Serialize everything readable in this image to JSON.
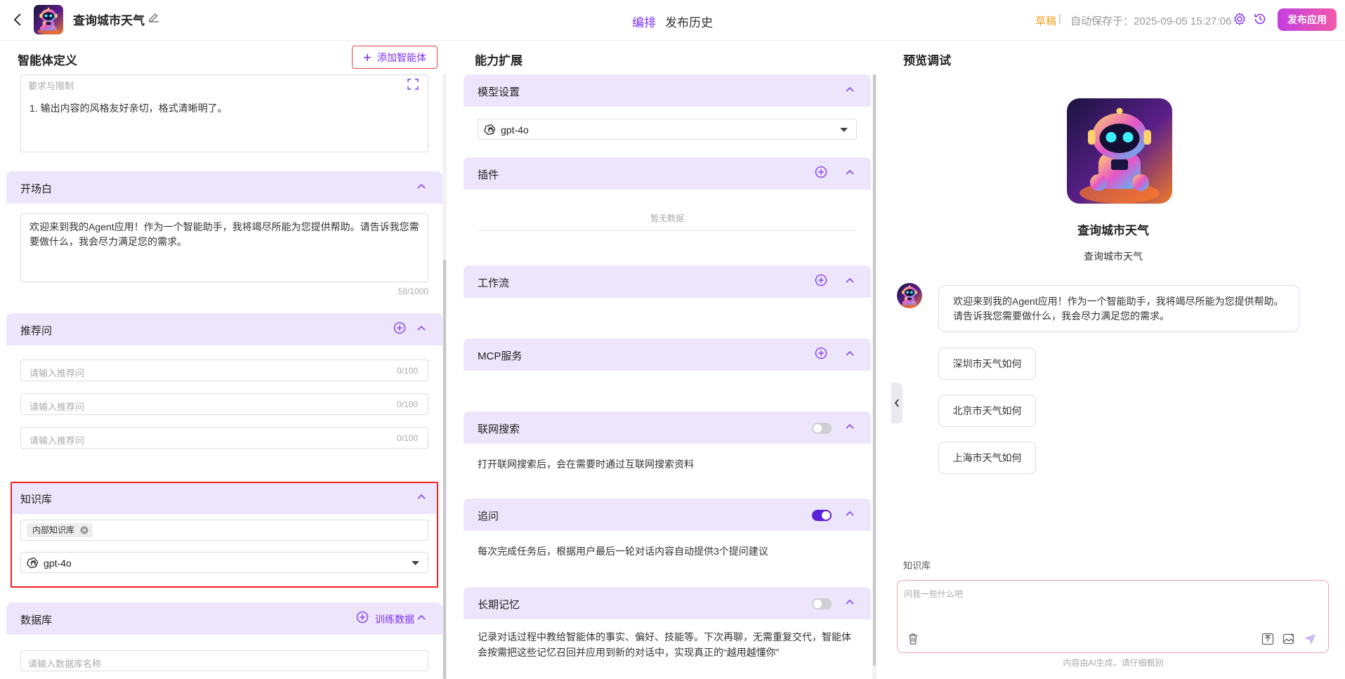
{
  "header": {
    "app_title": "查询城市天气",
    "tabs": [
      {
        "label": "编排",
        "active": true
      },
      {
        "label": "发布历史",
        "active": false
      }
    ],
    "draft": "草稿",
    "separator": "|",
    "autosave": "自动保存于：2025-09-05 15:27:06",
    "publish_label": "发布应用",
    "accent_color": "#7b2ff7"
  },
  "agent_def": {
    "title": "智能体定义",
    "add_agent_label": "添加智能体",
    "requirements": {
      "label": "要求与限制",
      "text": "1. 输出内容的风格友好亲切，格式清晰明了。"
    },
    "opening": {
      "title": "开场白",
      "text": "欢迎来到我的Agent应用！作为一个智能助手，我将竭尽所能为您提供帮助。请告诉我您需要做什么，我会尽力满足您的需求。",
      "counter": "58/1000"
    },
    "suggestions": {
      "title": "推荐问",
      "items": [
        {
          "placeholder": "请输入推荐问",
          "counter": "0/100"
        },
        {
          "placeholder": "请输入推荐问",
          "counter": "0/100"
        },
        {
          "placeholder": "请输入推荐问",
          "counter": "0/100"
        }
      ]
    },
    "knowledge": {
      "title": "知识库",
      "tag": "内部知识库",
      "model": "gpt-4o"
    },
    "database": {
      "title": "数据库",
      "train_label": "训练数据",
      "placeholder": "请输入数据库名称"
    }
  },
  "capabilities": {
    "title": "能力扩展",
    "model": {
      "title": "模型设置",
      "value": "gpt-4o"
    },
    "plugins": {
      "title": "插件",
      "empty": "暂无数据"
    },
    "workflow": {
      "title": "工作流"
    },
    "mcp": {
      "title": "MCP服务"
    },
    "web_search": {
      "title": "联网搜索",
      "enabled": false,
      "desc": "打开联网搜索后，会在需要时通过互联网搜索资料"
    },
    "follow_up": {
      "title": "追问",
      "enabled": true,
      "desc": "每次完成任务后，根据用户最后一轮对话内容自动提供3个提问建议"
    },
    "long_memory": {
      "title": "长期记忆",
      "enabled": false,
      "desc": "记录对话过程中教给智能体的事实、偏好、技能等。下次再聊，无需重复交代，智能体会按需把这些记忆召回并应用到新的对话中，实现真正的“越用越懂你”"
    }
  },
  "preview": {
    "title": "预览调试",
    "agent_name": "查询城市天气",
    "agent_desc": "查询城市天气",
    "welcome": "欢迎来到我的Agent应用！作为一个智能助手，我将竭尽所能为您提供帮助。请告诉我您需要做什么，我会尽力满足您的需求。",
    "suggestions": [
      "深圳市天气如何",
      "北京市天气如何",
      "上海市天气如何"
    ],
    "kb_label": "知识库",
    "input_placeholder": "问我一些什么吧",
    "footer": "内容由AI生成，请仔细甄别"
  }
}
